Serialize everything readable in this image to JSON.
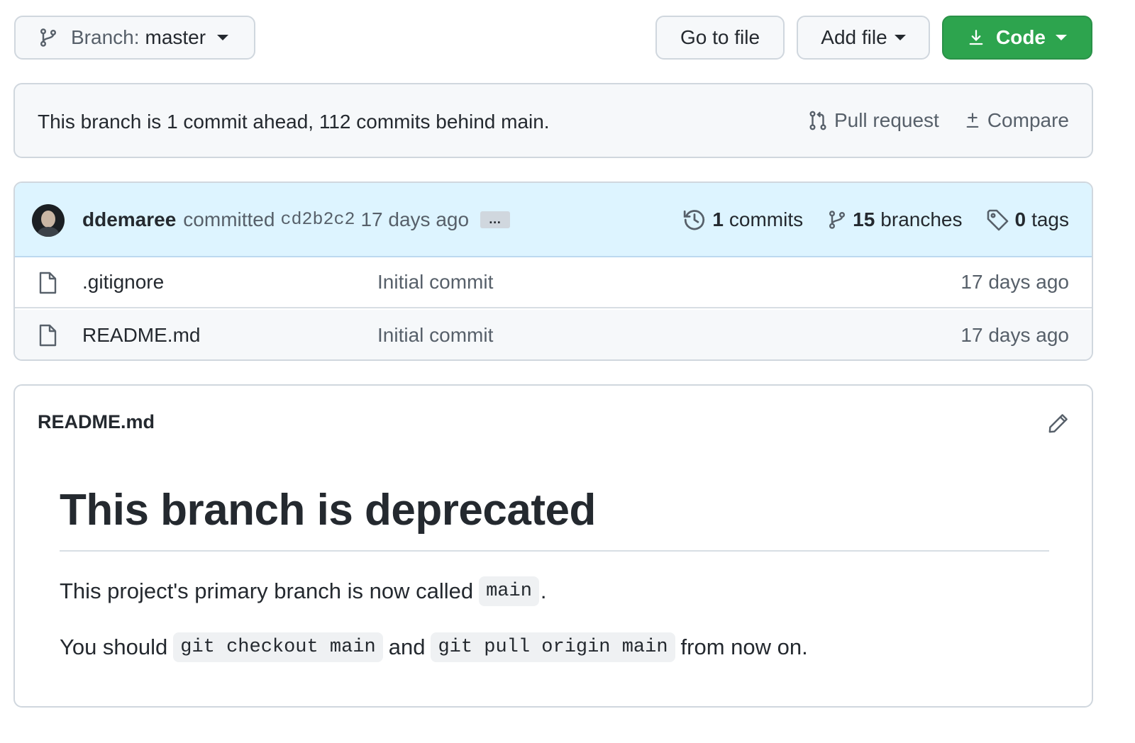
{
  "toolbar": {
    "branch_prefix": "Branch:",
    "branch_name": "master",
    "go_to_file": "Go to file",
    "add_file": "Add file",
    "code": "Code",
    "code_color": "#2da44e"
  },
  "branch_info": {
    "message": "This branch is 1 commit ahead, 112 commits behind main.",
    "pull_request": "Pull request",
    "compare": "Compare"
  },
  "commit": {
    "author": "ddemaree",
    "verb": "committed",
    "sha": "cd2b2c2",
    "time": "17 days ago",
    "ellipsis": "…",
    "commits_count": "1",
    "commits_label": "commits",
    "branches_count": "15",
    "branches_label": "branches",
    "tags_count": "0",
    "tags_label": "tags"
  },
  "files": [
    {
      "name": ".gitignore",
      "message": "Initial commit",
      "age": "17 days ago",
      "icon": "file-icon"
    },
    {
      "name": "README.md",
      "message": "Initial commit",
      "age": "17 days ago",
      "icon": "file-icon"
    }
  ],
  "readme": {
    "title": "README.md",
    "heading": "This branch is deprecated",
    "p1_before": "This project's primary branch is now called",
    "p1_code": "main",
    "p1_after": ".",
    "p2_before": "You should",
    "p2_code1": "git checkout main",
    "p2_mid": "and",
    "p2_code2": "git pull origin main",
    "p2_after": "from now on."
  }
}
